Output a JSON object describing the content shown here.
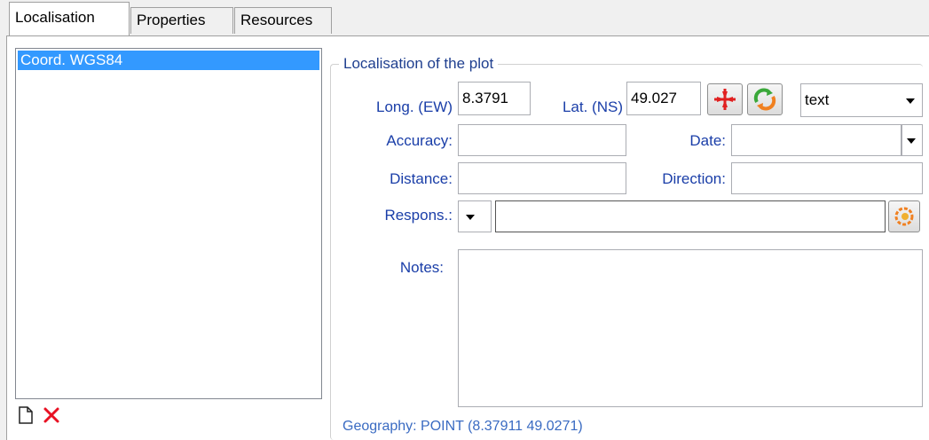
{
  "tabs": [
    {
      "label": "Localisation"
    },
    {
      "label": "Properties"
    },
    {
      "label": "Resources"
    }
  ],
  "list": {
    "items": [
      {
        "label": "Coord. WGS84"
      }
    ]
  },
  "toolbar": {
    "new_icon": "new-document-icon",
    "delete_icon": "delete-x-icon",
    "delete_color": "#e81123"
  },
  "group": {
    "legend": "Localisation of the plot",
    "long_label": "Long. (EW)",
    "long_value": "8.3791",
    "lat_label": "Lat. (NS)",
    "lat_value": "49.027",
    "format_value": "text",
    "accuracy_label": "Accuracy:",
    "accuracy_value": "",
    "date_label": "Date:",
    "date_value": "",
    "distance_label": "Distance:",
    "distance_value": "",
    "direction_label": "Direction:",
    "direction_value": "",
    "respons_label": "Respons.:",
    "respons_value": "",
    "notes_label": "Notes:",
    "notes_value": "",
    "geography": "Geography: POINT (8.37911 49.0271)"
  },
  "colors": {
    "selection": "#3399ff",
    "label_blue": "#1a3ea8",
    "crosshair_red": "#e02020"
  }
}
